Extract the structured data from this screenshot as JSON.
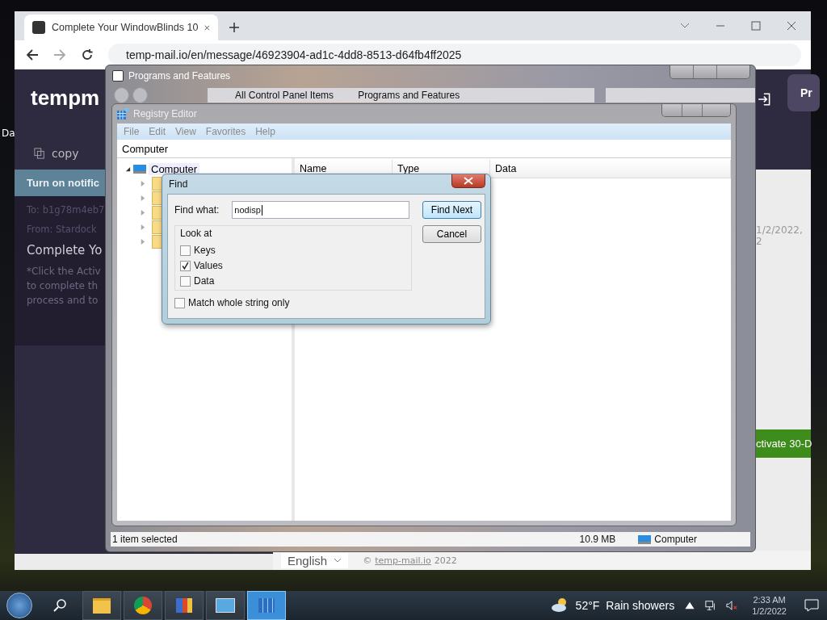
{
  "desktop": {
    "icon_label": "Da"
  },
  "browser": {
    "tab": {
      "title": "Complete Your WindowBlinds 10"
    },
    "url": "temp-mail.io/en/message/46923904-ad1c-4dd8-8513-d64fb4ff2025",
    "page": {
      "logo": "tempm",
      "copy": "copy",
      "notification": "Turn on notific",
      "to": "To: b1g78m4eb7",
      "from": "From: Stardock",
      "subject": "Complete Yo",
      "body": [
        "*Click the Activ",
        "to complete th",
        "process and to"
      ],
      "date": "1/2/2022, 2",
      "activate": "ctivate 30-D",
      "header_button": "Pr",
      "language": "English",
      "copyright_sign": "©",
      "copyright_link": "temp-mail.io",
      "copyright_year": "2022"
    }
  },
  "programs_window": {
    "title": "Programs and Features",
    "breadcrumb": [
      "All Control Panel Items",
      "Programs and Features"
    ],
    "status": "1 item selected",
    "size": "10.9 MB",
    "location": "Computer"
  },
  "registry": {
    "title": "Registry Editor",
    "menu": [
      "File",
      "Edit",
      "View",
      "Favorites",
      "Help"
    ],
    "address": "Computer",
    "tree": {
      "label": "Computer",
      "expanded": true
    },
    "columns": [
      "Name",
      "Type",
      "Data"
    ]
  },
  "find": {
    "title": "Find",
    "label": "Find what:",
    "value": "nodisp",
    "group": "Look at",
    "options": [
      {
        "label": "Keys",
        "checked": false
      },
      {
        "label": "Values",
        "checked": true
      },
      {
        "label": "Data",
        "checked": false
      }
    ],
    "match": {
      "label": "Match whole string only",
      "checked": false
    },
    "buttons": [
      "Find Next",
      "Cancel"
    ]
  },
  "taskbar": {
    "apps": [
      {
        "kind": "explorer",
        "selected": false
      },
      {
        "kind": "chrome",
        "selected": false
      },
      {
        "kind": "books",
        "selected": false
      },
      {
        "kind": "control",
        "selected": false
      },
      {
        "kind": "registry",
        "selected": true
      }
    ],
    "temperature": "52°F",
    "weather": "Rain showers",
    "time": "2:33 AM",
    "date": "1/2/2022"
  }
}
